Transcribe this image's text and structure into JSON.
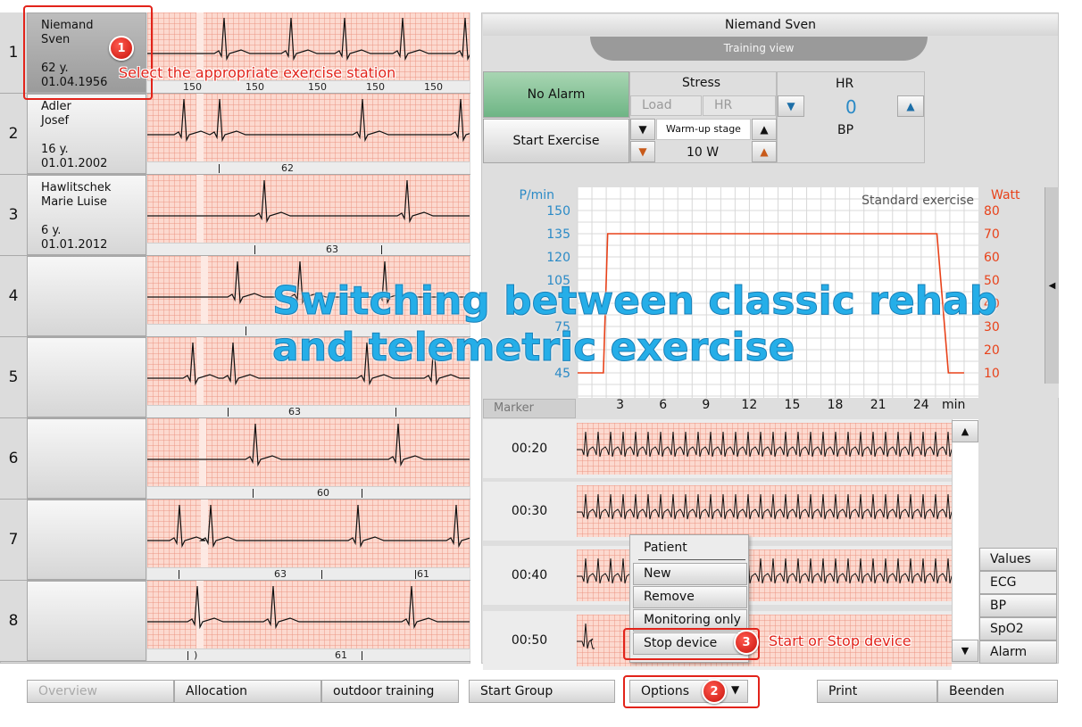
{
  "stations": [
    {
      "number": "1",
      "name_line1": "Niemand",
      "name_line2": "Sven",
      "age": "62 y.",
      "dob": "01.04.1956",
      "ruler_values": [
        "150",
        "150",
        "150",
        "150",
        "150"
      ]
    },
    {
      "number": "2",
      "name_line1": "Adler",
      "name_line2": "Josef",
      "age": "16 y.",
      "dob": "01.01.2002",
      "ruler_values": [
        "62"
      ]
    },
    {
      "number": "3",
      "name_line1": "Hawlitschek",
      "name_line2": "Marie Luise",
      "age": "6 y.",
      "dob": "01.01.2012",
      "ruler_values": [
        "63"
      ]
    },
    {
      "number": "4",
      "name_line1": "",
      "name_line2": "",
      "age": "",
      "dob": "",
      "ruler_values": []
    },
    {
      "number": "5",
      "name_line1": "",
      "name_line2": "",
      "age": "",
      "dob": "",
      "ruler_values": [
        "63"
      ]
    },
    {
      "number": "6",
      "name_line1": "",
      "name_line2": "",
      "age": "",
      "dob": "",
      "ruler_values": [
        "60"
      ]
    },
    {
      "number": "7",
      "name_line1": "",
      "name_line2": "",
      "age": "",
      "dob": "",
      "ruler_values": [
        "63",
        "61"
      ]
    },
    {
      "number": "8",
      "name_line1": "",
      "name_line2": "",
      "age": "",
      "dob": "",
      "ruler_values": [
        ")",
        "61"
      ]
    }
  ],
  "header": {
    "patient_name": "Niemand Sven",
    "view_label": "Training view"
  },
  "controls": {
    "alarm_label": "No Alarm",
    "start_exercise_label": "Start Exercise",
    "stress_label": "Stress",
    "load_label": "Load",
    "stress_hr_label": "HR",
    "stage_label": "Warm-up stage",
    "stage_value": "10 W",
    "hr_label": "HR",
    "hr_value": "0",
    "bp_label": "BP"
  },
  "chart_data": {
    "type": "line",
    "title": "Standard exercise",
    "ylabel_left": "P/min",
    "ylabel_right": "Watt",
    "xlabel": "min",
    "x_ticks": [
      3,
      6,
      9,
      12,
      15,
      18,
      21,
      24
    ],
    "y_left_ticks": [
      150,
      135,
      120,
      105,
      75,
      45
    ],
    "y_right_ticks": [
      80,
      70,
      60,
      50,
      40,
      30,
      20,
      10
    ],
    "x_range": [
      0,
      28
    ],
    "y_right_range": [
      5,
      85
    ],
    "grid": true,
    "series": [
      {
        "color": "#e8421a",
        "x": [
          0,
          1.8,
          2.1,
          25.1,
          25.9,
          27
        ],
        "y": [
          10,
          10,
          70,
          70,
          10,
          10
        ]
      }
    ],
    "colors": {
      "left_axis": "#2a8ac6",
      "right_axis": "#e8421a"
    }
  },
  "marker": {
    "button_label": "Marker",
    "rows": [
      {
        "time": "00:20"
      },
      {
        "time": "00:30"
      },
      {
        "time": "00:40"
      },
      {
        "time": "00:50"
      }
    ]
  },
  "side_tabs": [
    "Values",
    "ECG",
    "BP",
    "SpO2",
    "Alarm"
  ],
  "context_menu": {
    "header": "Patient",
    "items": [
      "New",
      "Remove",
      "Monitoring only",
      "Stop device"
    ]
  },
  "bottom_bar": {
    "overview": "Overview",
    "allocation": "Allocation",
    "outdoor_training": "outdoor training",
    "start_group": "Start Group",
    "options": "Options",
    "print": "Print",
    "beenden": "Beenden"
  },
  "annotations": {
    "badge1": "1",
    "note1": "Select the appropriate exercise station",
    "badge2": "2",
    "badge3": "3",
    "note3": "Start or Stop device",
    "overlay_line1": "Switching between classic rehab",
    "overlay_line2": "and telemetric exercise"
  }
}
